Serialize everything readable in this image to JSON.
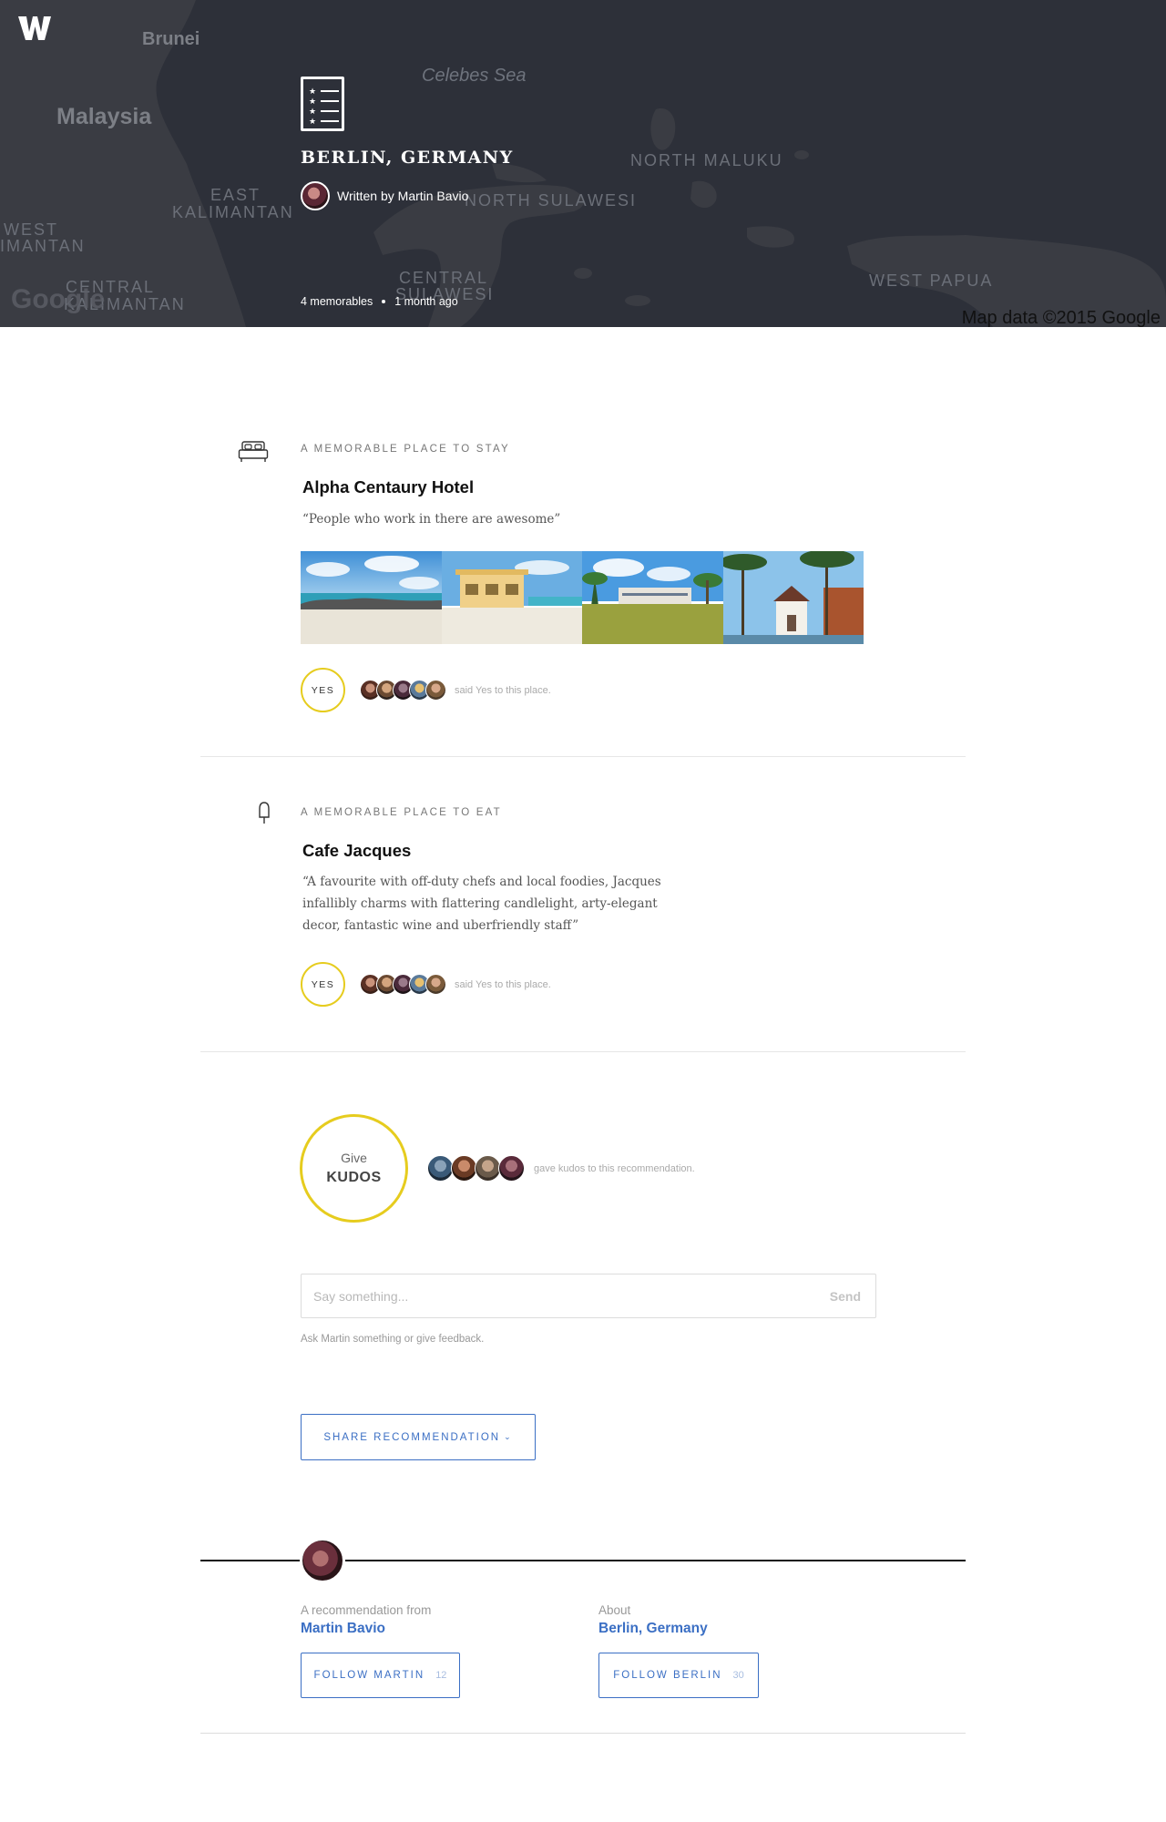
{
  "hero": {
    "title": "BERLIN, GERMANY",
    "author": "Written by Martin Bavio",
    "memorables": "4 memorables",
    "time": "1 month ago",
    "map_credit": "Map data ©2015 Google",
    "google_mark": "Google",
    "map_labels": {
      "brunei": "Brunei",
      "malaysia": "Malaysia",
      "celebes": "Celebes Sea",
      "north_maluku": "NORTH MALUKU",
      "east_kalimantan_1": "EAST",
      "east_kalimantan_2": "KALIMANTAN",
      "north_sulawesi": "NORTH SULAWESI",
      "west_kalimantan_1": "WEST",
      "west_kalimantan_2": "IMANTAN",
      "central_kalimantan_1": "CENTRAL",
      "central_kalimantan_2": "KALIMANTAN",
      "central_sulawesi_1": "CENTRAL",
      "central_sulawesi_2": "SULAWESI",
      "west_papua": "WEST PAPUA"
    },
    "logo_icon": "w-logo-icon",
    "doc_icon": "recommendation-list-icon"
  },
  "stay": {
    "kicker": "A MEMORABLE PLACE TO STAY",
    "name": "Alpha Centaury Hotel",
    "quote": "“People who work in there are awesome”",
    "yes_label": "YES",
    "said": "said Yes to this place.",
    "icon": "bed-icon"
  },
  "eat": {
    "kicker": "A MEMORABLE PLACE TO EAT",
    "name": "Cafe Jacques",
    "quote": "“A favourite with off-duty chefs and local foodies, Jacques infallibly charms with flattering candlelight, arty-elegant decor, fantastic wine and uberfriendly staff”",
    "yes_label": "YES",
    "said": "said Yes to this place.",
    "icon": "popsicle-icon"
  },
  "kudos": {
    "give": "Give",
    "label": "KUDOS",
    "said": "gave kudos to this recommendation."
  },
  "comment": {
    "placeholder": "Say something...",
    "send": "Send",
    "hint": "Ask Martin something or give feedback."
  },
  "share": {
    "label": "SHARE RECOMMENDATION",
    "chevron": "⌄"
  },
  "footer": {
    "from_label": "A recommendation from",
    "from_name": "Martin Bavio",
    "follow_martin": "FOLLOW MARTIN",
    "follow_martin_count": "12",
    "about_label": "About",
    "about_value": "Berlin, Germany",
    "follow_berlin": "FOLLOW BERLIN",
    "follow_berlin_count": "30"
  },
  "colors": {
    "accent_yellow": "#e6cc1e",
    "link_blue": "#3b6fc4",
    "hero_bg": "#2d3039"
  }
}
